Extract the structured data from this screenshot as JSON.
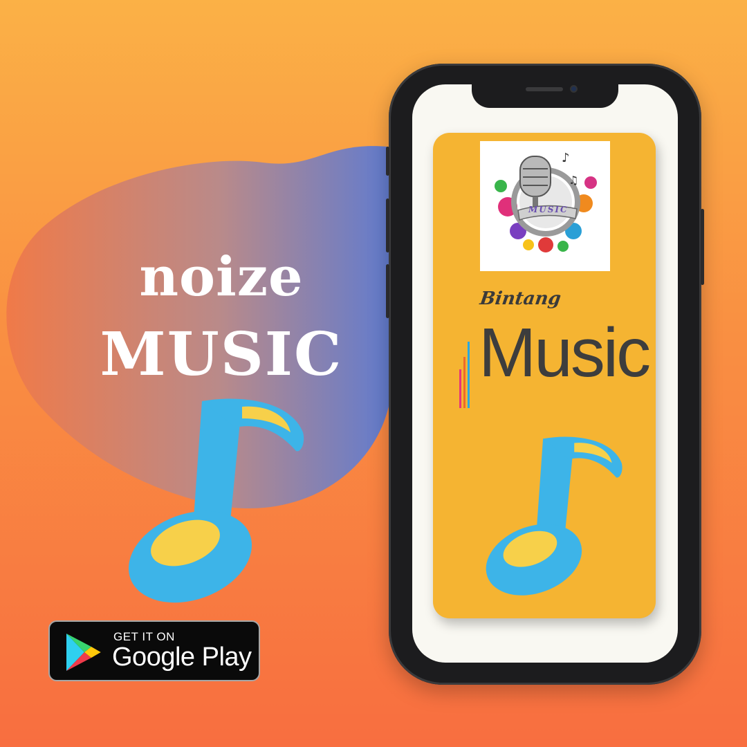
{
  "headline": {
    "line1": "noize",
    "line2": "MUSIC"
  },
  "store_badge": {
    "top_text": "GET IT ON",
    "main_text": "Google Play",
    "logo_icon": "google-play-logo-icon"
  },
  "app_screen": {
    "icon_label": "MUSIC",
    "brand_small": "Bintang",
    "brand_large": "Music"
  },
  "colors": {
    "background_top": "#fbb146",
    "background_bottom": "#f86e40",
    "note_blue": "#3db4e8",
    "note_yellow": "#f7d04a",
    "card_yellow": "#f5b432"
  }
}
